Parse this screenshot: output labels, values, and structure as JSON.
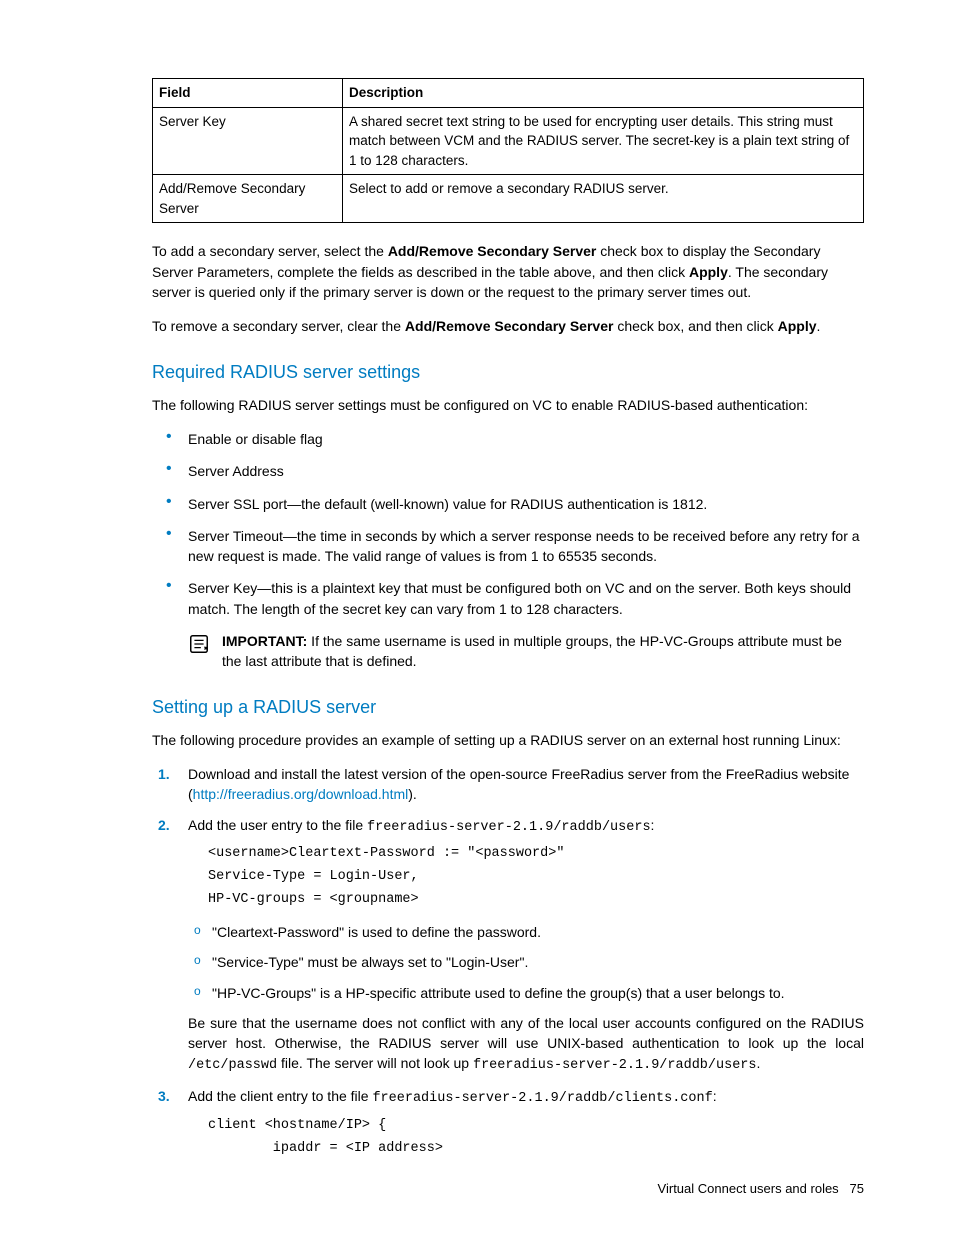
{
  "table": {
    "header_field": "Field",
    "header_desc": "Description",
    "rows": [
      {
        "field": "Server Key",
        "desc": "A shared secret text string to be used for encrypting user details. This string must match between VCM and the RADIUS server. The secret-key is a plain text string of 1 to 128 characters."
      },
      {
        "field": "Add/Remove Secondary Server",
        "desc": "Select to add or remove a secondary RADIUS server."
      }
    ]
  },
  "para1_a": "To add a secondary server, select the ",
  "para1_b": "Add/Remove Secondary Server",
  "para1_c": " check box to display the Secondary Server Parameters, complete the fields as described in the table above, and then click ",
  "para1_d": "Apply",
  "para1_e": ". The secondary server is queried only if the primary server is down or the request to the primary server times out.",
  "para2_a": "To remove a secondary server, clear the ",
  "para2_b": "Add/Remove Secondary Server",
  "para2_c": " check box, and then click ",
  "para2_d": "Apply",
  "para2_e": ".",
  "sec1_title": "Required RADIUS server settings",
  "sec1_intro": "The following RADIUS server settings must be configured on VC to enable RADIUS-based authentication:",
  "sec1_items": [
    "Enable or disable flag",
    "Server Address",
    "Server SSL port—the default (well-known) value for RADIUS authentication is 1812.",
    "Server Timeout—the time in seconds by which a server response needs to be received before any retry for a new request is made. The valid range of values is from 1 to 65535 seconds.",
    "Server Key—this is a plaintext key that must be configured both on VC and on the server. Both keys should match. The length of the secret key can vary from 1 to 128 characters."
  ],
  "important_label": "IMPORTANT:",
  "important_text": "  If the same username is used in multiple groups, the HP-VC-Groups attribute must be the last attribute that is defined.",
  "sec2_title": "Setting up a RADIUS server",
  "sec2_intro": "The following procedure provides an example of setting up a RADIUS server on an external host running Linux:",
  "step1_a": "Download and install the latest version of the open-source FreeRadius server from the FreeRadius website (",
  "step1_link": "http://freeradius.org/download.html",
  "step1_b": ").",
  "step2_a": "Add the user entry to the file ",
  "step2_file": "freeradius-server-2.1.9/raddb/users",
  "step2_b": ":",
  "step2_code": "<username>Cleartext-Password := \"<password>\"\nService-Type = Login-User,\nHP-VC-groups = <groupname>",
  "step2_sub": [
    "\"Cleartext-Password\" is used to define the password.",
    "\"Service-Type\" must be always set to \"Login-User\".",
    "\"HP-VC-Groups\" is a HP-specific attribute used to define the group(s) that a user belongs to."
  ],
  "step2_note_a": "Be sure that the username does not conflict with any of the local user accounts configured on the RADIUS server host. Otherwise, the RADIUS server will use UNIX-based authentication to look up the local ",
  "step2_note_mono1": "/etc/passwd",
  "step2_note_b": " file. The server will not look up ",
  "step2_note_mono2": "freeradius-server-2.1.9/raddb/users",
  "step2_note_c": ".",
  "step3_a": "Add the client entry to the file ",
  "step3_file": "freeradius-server-2.1.9/raddb/clients.conf",
  "step3_b": ":",
  "step3_code": "client <hostname/IP> {\n        ipaddr = <IP address>",
  "footer_text": "Virtual Connect users and roles",
  "footer_page": "75"
}
